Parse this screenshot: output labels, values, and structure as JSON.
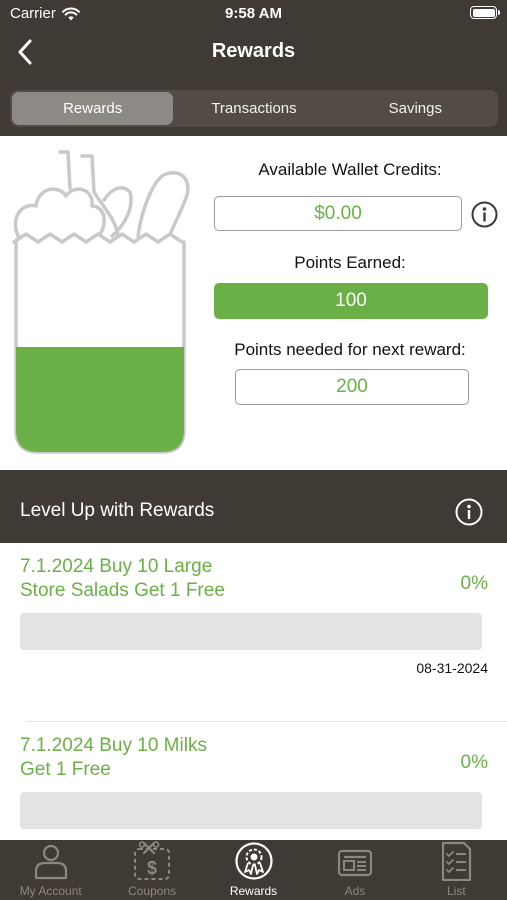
{
  "status": {
    "carrier": "Carrier",
    "time": "9:58 AM"
  },
  "header": {
    "title": "Rewards"
  },
  "tabs": [
    {
      "label": "Rewards",
      "active": true
    },
    {
      "label": "Transactions",
      "active": false
    },
    {
      "label": "Savings",
      "active": false
    }
  ],
  "wallet": {
    "credits_label": "Available Wallet Credits:",
    "credits_value": "$0.00",
    "points_label": "Points Earned:",
    "points_value": "100",
    "needed_label": "Points needed for next reward:",
    "needed_value": "200",
    "bag_fill_fraction": 0.5
  },
  "level_up": {
    "title": "Level Up with Rewards"
  },
  "rewards": [
    {
      "name_line1": "7.1.2024 Buy 10 Large",
      "name_line2": "Store Salads Get 1 Free",
      "percent": "0%",
      "progress": 0,
      "date": "08-31-2024"
    },
    {
      "name_line1": "7.1.2024 Buy 10 Milks",
      "name_line2": "Get 1 Free",
      "percent": "0%",
      "progress": 0,
      "date": ""
    }
  ],
  "bottom_nav": [
    {
      "label": "My Account",
      "icon": "person-icon",
      "active": false
    },
    {
      "label": "Coupons",
      "icon": "coupon-icon",
      "active": false
    },
    {
      "label": "Rewards",
      "icon": "rewards-badge-icon",
      "active": true
    },
    {
      "label": "Ads",
      "icon": "ads-icon",
      "active": false
    },
    {
      "label": "List",
      "icon": "list-icon",
      "active": false
    }
  ],
  "colors": {
    "brand_dark": "#3f3a33",
    "accent_green": "#6bb047",
    "inactive_tab": "#8c877f"
  }
}
